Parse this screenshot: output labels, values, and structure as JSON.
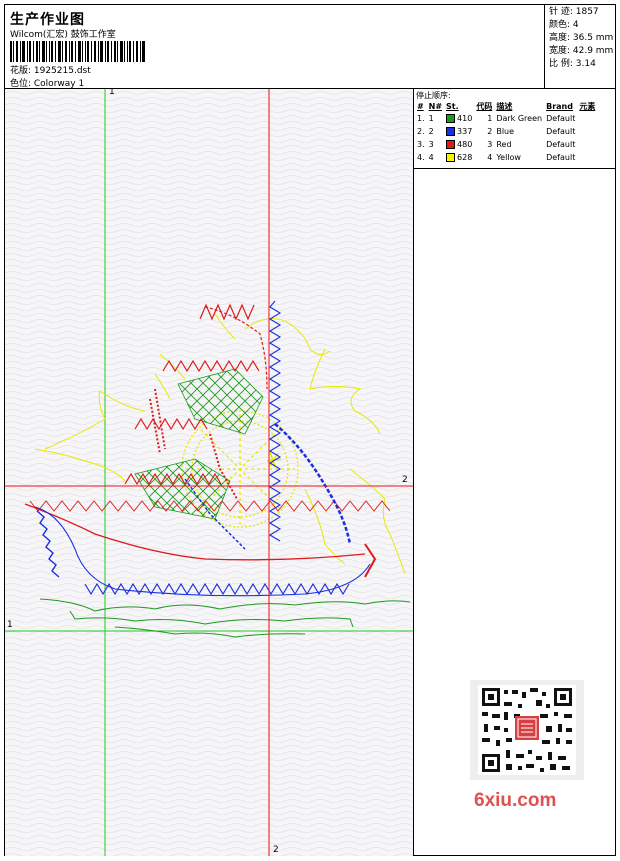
{
  "header": {
    "title": "生产作业图",
    "subtitle": "Wilcom(汇宏) 鼓饰工作室",
    "design_label": "花版: 1925215.dst",
    "colorway_label": "色位: Colorway 1"
  },
  "stats": {
    "stitches": "针 迹: 1857",
    "colors": "颜色: 4",
    "height": "高度: 36.5 mm",
    "width": "宽度: 42.9 mm",
    "scale": "比 例: 3.14"
  },
  "stop_sequence": {
    "title": "停止顺序:",
    "headers": [
      "#",
      "N#",
      "St.",
      "代码",
      "描述",
      "Brand",
      "元素"
    ],
    "rows": [
      {
        "num": "1.",
        "n": "1",
        "color": "#1f9a1f",
        "st": "410",
        "code": "1",
        "desc": "Dark Green",
        "brand": "Default"
      },
      {
        "num": "2.",
        "n": "2",
        "color": "#1a2fe0",
        "st": "337",
        "code": "2",
        "desc": "Blue",
        "brand": "Default"
      },
      {
        "num": "3.",
        "n": "3",
        "color": "#e01a1a",
        "st": "480",
        "code": "3",
        "desc": "Red",
        "brand": "Default"
      },
      {
        "num": "4.",
        "n": "4",
        "color": "#f5f500",
        "st": "628",
        "code": "4",
        "desc": "Yellow",
        "brand": "Default"
      }
    ]
  },
  "axes": {
    "green_v_top": "1",
    "green_h_left": "1",
    "red_h_right": "2",
    "red_v_bottom": "2"
  },
  "watermark": {
    "brand": "6xiu.com"
  },
  "colors": {
    "green": "#1f9a1f",
    "blue": "#1a2fe0",
    "red": "#e01a1a",
    "yellow": "#f5f500"
  }
}
